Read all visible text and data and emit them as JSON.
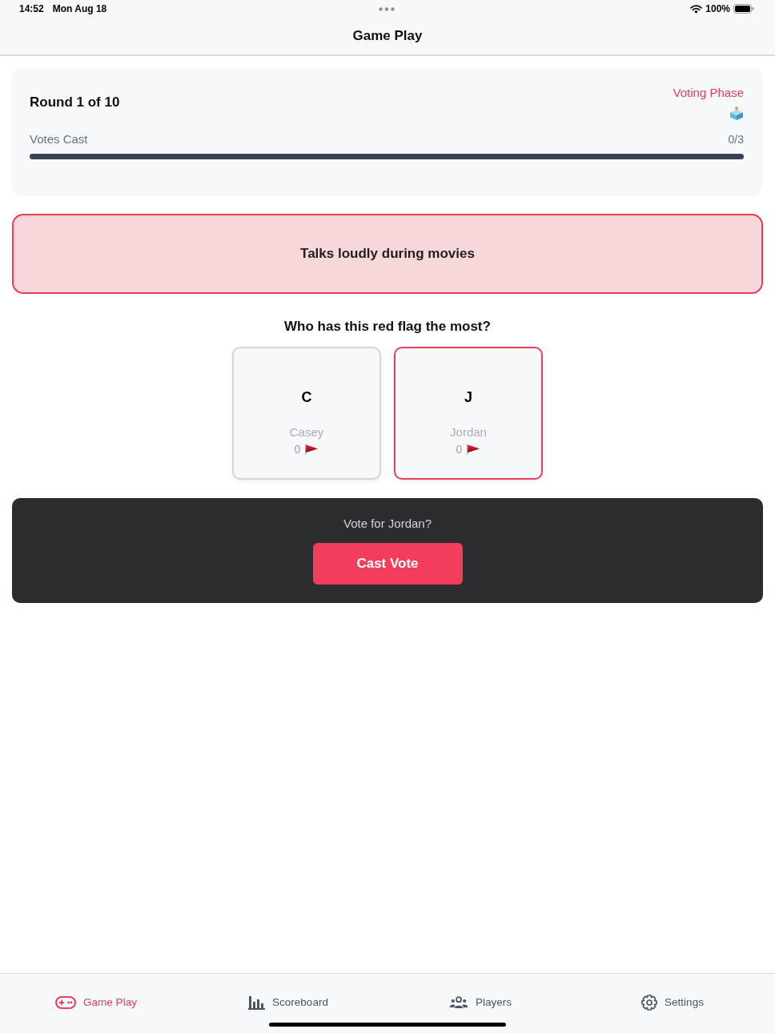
{
  "status_bar": {
    "time": "14:52",
    "date": "Mon Aug 18",
    "battery": "100%"
  },
  "nav": {
    "title": "Game Play"
  },
  "round": {
    "title": "Round 1 of 10",
    "phase": "Voting Phase",
    "progress": {
      "label": "Votes Cast",
      "reading": "0/3",
      "level": 0
    }
  },
  "red_flag": {
    "text": "Talks loudly during movies"
  },
  "question": "Who has this red flag the most?",
  "players": [
    {
      "initial": "C",
      "name": "Casey",
      "flags": "0",
      "selected": false
    },
    {
      "initial": "J",
      "name": "Jordan",
      "flags": "0",
      "selected": true
    }
  ],
  "confirm": {
    "prompt": "Vote for Jordan?",
    "button": "Cast Vote"
  },
  "tab_bar": [
    {
      "label": "Game Play",
      "kind": "controller",
      "selected": true
    },
    {
      "label": "Scoreboard",
      "kind": "chart",
      "selected": false
    },
    {
      "label": "Players",
      "kind": "people",
      "selected": false
    },
    {
      "label": "Settings",
      "kind": "gear",
      "selected": false
    }
  ]
}
